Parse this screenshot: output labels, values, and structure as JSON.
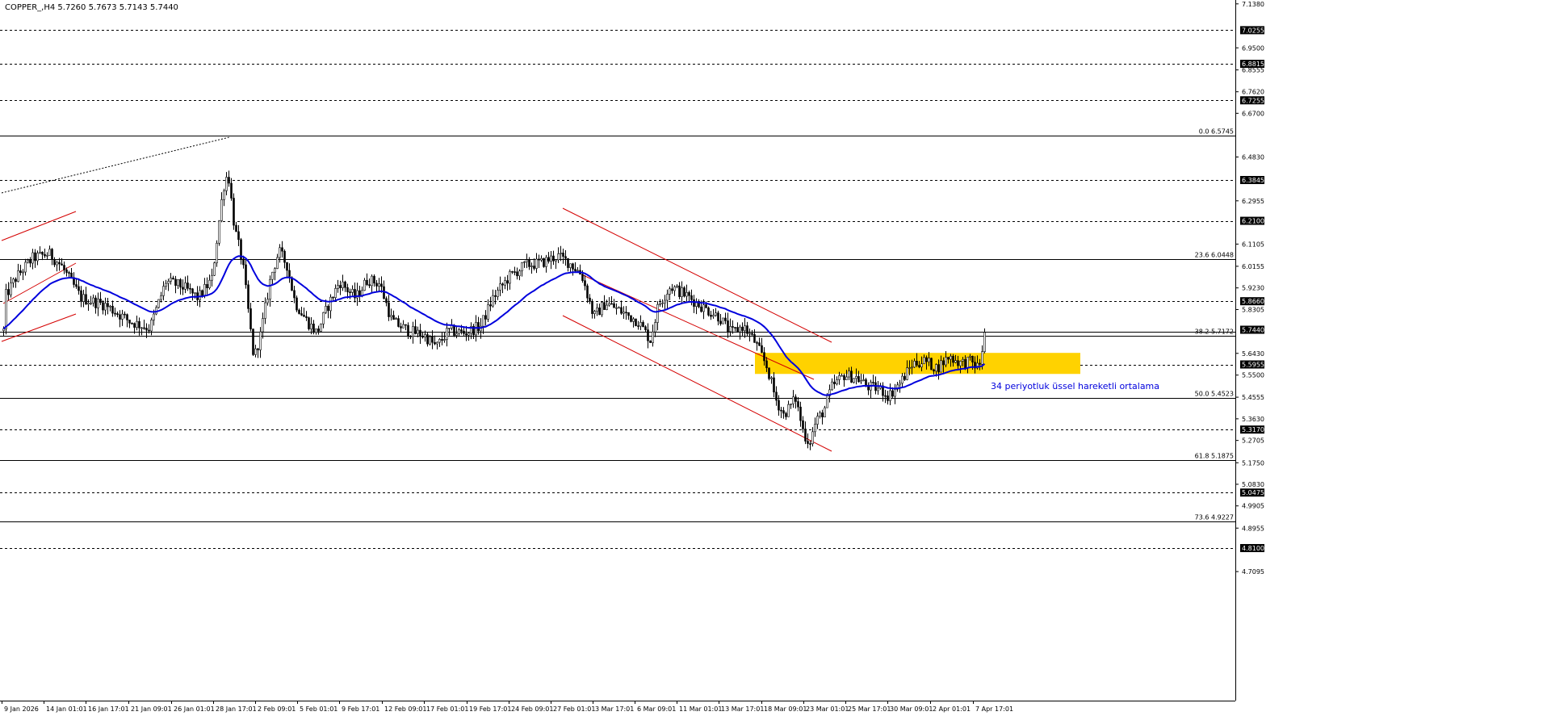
{
  "header": {
    "symbol_info": "COPPER_,H4  5.7260 5.7673 5.7143 5.7440"
  },
  "colors": {
    "background": "#ffffff",
    "axis": "#000000",
    "grid_dotted": "#000000",
    "candle_bull": "#ffffff",
    "candle_bear": "#000000",
    "ema": "#0000dd",
    "channel": "#d40000",
    "zone": "#ffd200",
    "annotation_text": "#0000dd",
    "price_tag_bg": "#000000",
    "price_tag_fg": "#ffffff"
  },
  "chart_data": {
    "type": "candlestick",
    "instrument": "COPPER_",
    "timeframe": "H4",
    "ohlc_last": {
      "open": 5.726,
      "high": 5.7673,
      "low": 5.7143,
      "close": 5.744
    },
    "ylim": [
      4.7,
      7.1
    ],
    "y_ticks": [
      "7.1380",
      "6.9500",
      "6.8555",
      "6.7620",
      "6.6700",
      "6.4830",
      "6.2955",
      "6.1105",
      "6.0155",
      "5.9230",
      "5.8305",
      "5.6430",
      "5.5500",
      "5.4555",
      "5.3630",
      "5.2705",
      "5.1750",
      "5.0830",
      "4.9905",
      "4.8955",
      "4.7095"
    ],
    "x_labels": [
      "9 Jan 2026",
      "14 Jan 01:01",
      "16 Jan 17:01",
      "21 Jan 09:01",
      "26 Jan 01:01",
      "28 Jan 17:01",
      "2 Feb 09:01",
      "5 Feb 01:01",
      "9 Feb 17:01",
      "12 Feb 09:01",
      "17 Feb 01:01",
      "19 Feb 17:01",
      "24 Feb 09:01",
      "27 Feb 01:01",
      "3 Mar 17:01",
      "6 Mar 09:01",
      "11 Mar 01:01",
      "13 Mar 17:01",
      "18 Mar 09:01",
      "23 Mar 01:01",
      "25 Mar 17:01",
      "30 Mar 09:01",
      "2 Apr 01:01",
      "7 Apr 17:01"
    ],
    "horizontal_levels": [
      {
        "price": 7.0255,
        "label": "7.0255",
        "style": "dotted"
      },
      {
        "price": 6.8815,
        "label": "6.8815",
        "style": "dotted"
      },
      {
        "price": 6.7255,
        "label": "6.7255",
        "style": "dotted"
      },
      {
        "price": 6.3845,
        "label": "6.3845",
        "style": "dotted"
      },
      {
        "price": 6.21,
        "label": "6.2100",
        "style": "dotted"
      },
      {
        "price": 5.866,
        "label": "5.8660",
        "style": "dotted"
      },
      {
        "price": 5.5955,
        "label": "5.5955",
        "style": "dotted"
      },
      {
        "price": 5.317,
        "label": "5.3170",
        "style": "dotted"
      },
      {
        "price": 5.0475,
        "label": "5.0475",
        "style": "dotted"
      },
      {
        "price": 4.81,
        "label": "4.8100",
        "style": "dotted"
      }
    ],
    "fibonacci_levels": [
      {
        "price": 6.5745,
        "label": "0.0 6.5745"
      },
      {
        "price": 6.0448,
        "label": "23.6 6.0448"
      },
      {
        "price": 5.7172,
        "label": "38.2 5.7172"
      },
      {
        "price": 5.4523,
        "label": "50.0 5.4523"
      },
      {
        "price": 5.1875,
        "label": "61.8 5.1875"
      },
      {
        "price": 4.9227,
        "label": "73.6 4.9227"
      }
    ],
    "current_price": {
      "price": 5.744,
      "label": "5.7440"
    },
    "annotation": "34 periyotluk üssel hareketli ortalama",
    "ema_period": 34
  }
}
